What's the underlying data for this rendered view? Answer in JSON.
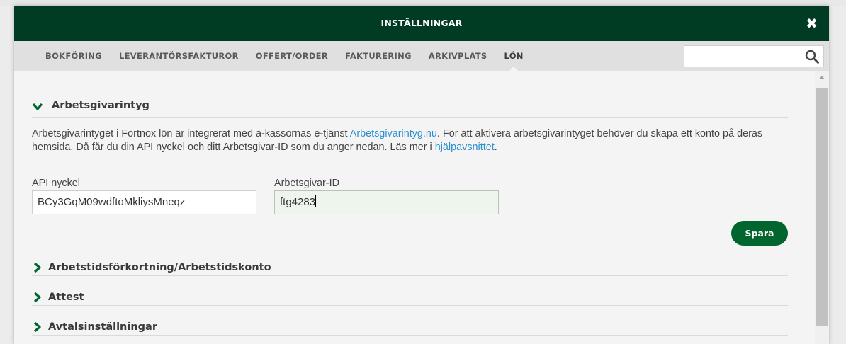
{
  "modal": {
    "title": "INSTÄLLNINGAR",
    "close_icon": "close-icon"
  },
  "tabs": [
    {
      "label": "BOKFÖRING",
      "active": false
    },
    {
      "label": "LEVERANTÖRSFAKTUROR",
      "active": false
    },
    {
      "label": "OFFERT/ORDER",
      "active": false
    },
    {
      "label": "FAKTURERING",
      "active": false
    },
    {
      "label": "ARKIVPLATS",
      "active": false
    },
    {
      "label": "LÖN",
      "active": true
    }
  ],
  "search": {
    "value": "",
    "placeholder": "",
    "icon": "search-icon"
  },
  "sections": [
    {
      "title": "Arbetsgivarintyg",
      "expanded": true
    },
    {
      "title": "Arbetstidsförkortning/Arbetstidskonto",
      "expanded": false
    },
    {
      "title": "Attest",
      "expanded": false
    },
    {
      "title": "Avtalsinställningar",
      "expanded": false
    }
  ],
  "arbetsgivarintyg": {
    "desc_part1": "Arbetsgivarintyget i Fortnox lön är integrerat med a-kassornas e-tjänst ",
    "link1": "Arbetsgivarintyg.nu",
    "desc_part2": ". För att aktivera arbetsgivarintyget behöver du skapa ett konto på deras hemsida. Då får du din API nyckel och ditt Arbetsgivar-ID som du anger nedan. Läs mer i ",
    "link2": "hjälpavsnittet",
    "desc_part3": ".",
    "api_label": "API nyckel",
    "api_value": "BCy3GqM09wdftoMkliysMneqz",
    "id_label": "Arbetsgivar-ID",
    "id_value": "ftg4283",
    "save_label": "Spara"
  },
  "colors": {
    "header_bg": "#003b24",
    "accent_green": "#00662e",
    "link": "#2a8fd0"
  }
}
